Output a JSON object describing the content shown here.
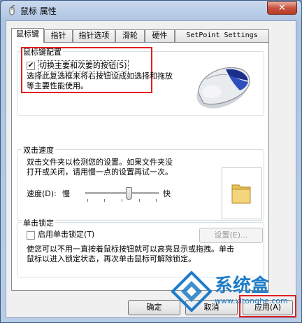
{
  "window": {
    "title": "鼠标 属性",
    "close_glyph": "✕"
  },
  "tabs": [
    {
      "label": "鼠标键"
    },
    {
      "label": "指针"
    },
    {
      "label": "指针选项"
    },
    {
      "label": "滑轮"
    },
    {
      "label": "硬件"
    },
    {
      "label": "SetPoint Settings"
    }
  ],
  "button_config": {
    "title": "鼠标键配置",
    "switch_label": "切换主要和次要的按钮(S)",
    "switch_checked": true,
    "desc_line1": "选择此复选框来将右按钮设成如选择和拖放",
    "desc_line2": "等主要性能使用。"
  },
  "double_click": {
    "title": "双击速度",
    "desc_line1": "双击文件夹以检测您的设置。如果文件夹没",
    "desc_line2": "打开或关闭，请用慢一点的设置再试一次。",
    "speed_label": "速度(D):",
    "slow_label": "慢",
    "fast_label": "快",
    "speed_level": 0.6
  },
  "click_lock": {
    "title": "单击锁定",
    "enable_label": "启用单击锁定(T)",
    "enable_checked": false,
    "settings_button": "设置(E)...",
    "desc_line1": "使您可以不用一直按着鼠标按钮就可以高亮显示或拖拽。单击",
    "desc_line2": "鼠标以进入锁定状态，再次单击鼠标可解除锁定。"
  },
  "footer": {
    "ok": "确定",
    "cancel": "取消",
    "apply": "应用(A)"
  },
  "watermark": {
    "brand": "系统盒",
    "url": "www.xitonghe.com"
  },
  "colors": {
    "highlight_box": "#e02020",
    "watermark_blue": "#1e7cc8"
  }
}
